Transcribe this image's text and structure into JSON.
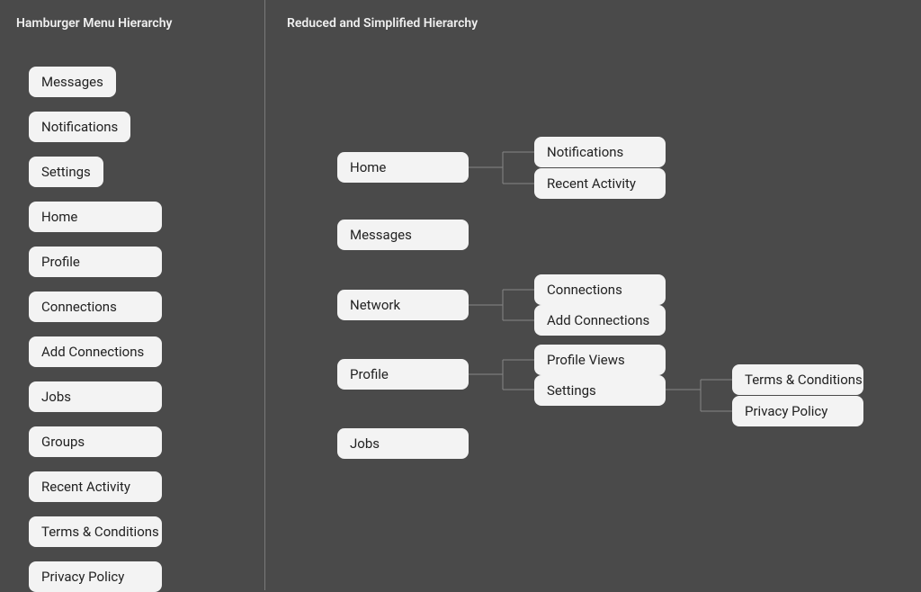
{
  "left": {
    "title": "Hamburger Menu Hierarchy",
    "items": [
      "Messages",
      "Notifications",
      "Settings",
      "Home",
      "Profile",
      "Connections",
      "Add Connections",
      "Jobs",
      "Groups",
      "Recent Activity",
      "Terms & Conditions",
      "Privacy Policy"
    ]
  },
  "right": {
    "title": "Reduced and Simplified Hierarchy",
    "tree": {
      "home": {
        "label": "Home",
        "children": {
          "notifications": "Notifications",
          "recent_activity": "Recent Activity"
        }
      },
      "messages": {
        "label": "Messages"
      },
      "network": {
        "label": "Network",
        "children": {
          "connections": "Connections",
          "add_connections": "Add Connections"
        }
      },
      "profile": {
        "label": "Profile",
        "children": {
          "profile_views": "Profile Views",
          "settings": {
            "label": "Settings",
            "children": {
              "terms": "Terms & Conditions",
              "privacy": "Privacy Policy"
            }
          }
        }
      },
      "jobs": {
        "label": "Jobs"
      }
    }
  }
}
